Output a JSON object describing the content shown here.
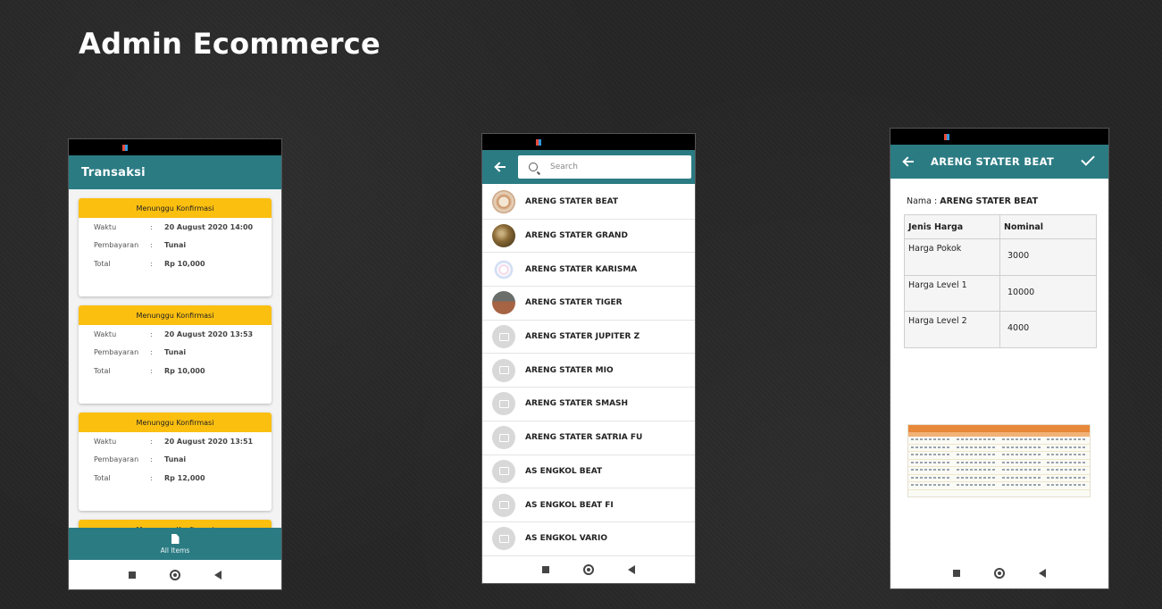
{
  "page": {
    "title": "Admin Ecommerce"
  },
  "phone1": {
    "appbar_title": "Transaksi",
    "transactions": [
      {
        "status": "Menunggu Konfirmasi",
        "waktu_label": "Waktu",
        "waktu": "20 August 2020 14:00",
        "pembayaran_label": "Pembayaran",
        "pembayaran": "Tunai",
        "total_label": "Total",
        "total": "Rp 10,000"
      },
      {
        "status": "Menunggu Konfirmasi",
        "waktu_label": "Waktu",
        "waktu": "20 August 2020 13:53",
        "pembayaran_label": "Pembayaran",
        "pembayaran": "Tunai",
        "total_label": "Total",
        "total": "Rp 10,000"
      },
      {
        "status": "Menunggu Konfirmasi",
        "waktu_label": "Waktu",
        "waktu": "20 August 2020 13:51",
        "pembayaran_label": "Pembayaran",
        "pembayaran": "Tunai",
        "total_label": "Total",
        "total": "Rp 12,000"
      },
      {
        "status": "Menunggu Konfirmasi"
      }
    ],
    "separator": ":",
    "bottom_tab": {
      "label": "All Items",
      "icon": "document-icon"
    },
    "colors": {
      "teal": "#2b7b83",
      "status": "#fbbf10"
    }
  },
  "phone2": {
    "search": {
      "placeholder": "Search",
      "value": ""
    },
    "products": [
      {
        "name": "ARENG STATER BEAT",
        "thumb": "p1"
      },
      {
        "name": "ARENG STATER GRAND",
        "thumb": "p2"
      },
      {
        "name": "ARENG STATER KARISMA",
        "thumb": "p3"
      },
      {
        "name": "ARENG STATER TIGER",
        "thumb": "p4"
      },
      {
        "name": "ARENG STATER JUPITER Z",
        "thumb": "ph"
      },
      {
        "name": "ARENG STATER MIO",
        "thumb": "ph"
      },
      {
        "name": "ARENG STATER SMASH",
        "thumb": "ph"
      },
      {
        "name": "ARENG STATER SATRIA FU",
        "thumb": "ph"
      },
      {
        "name": "AS ENGKOL BEAT",
        "thumb": "ph"
      },
      {
        "name": "AS ENGKOL BEAT FI",
        "thumb": "ph"
      },
      {
        "name": "AS ENGKOL VARIO",
        "thumb": "ph"
      }
    ]
  },
  "phone3": {
    "appbar_title": "ARENG STATER BEAT",
    "nama_label": "Nama :",
    "nama_value": "ARENG STATER BEAT",
    "table": {
      "headers": [
        "Jenis Harga",
        "Nominal"
      ],
      "rows": [
        {
          "jenis": "Harga Pokok",
          "nominal": "3000"
        },
        {
          "jenis": "Harga Level 1",
          "nominal": "10000"
        },
        {
          "jenis": "Harga Level 2",
          "nominal": "4000"
        }
      ]
    }
  }
}
